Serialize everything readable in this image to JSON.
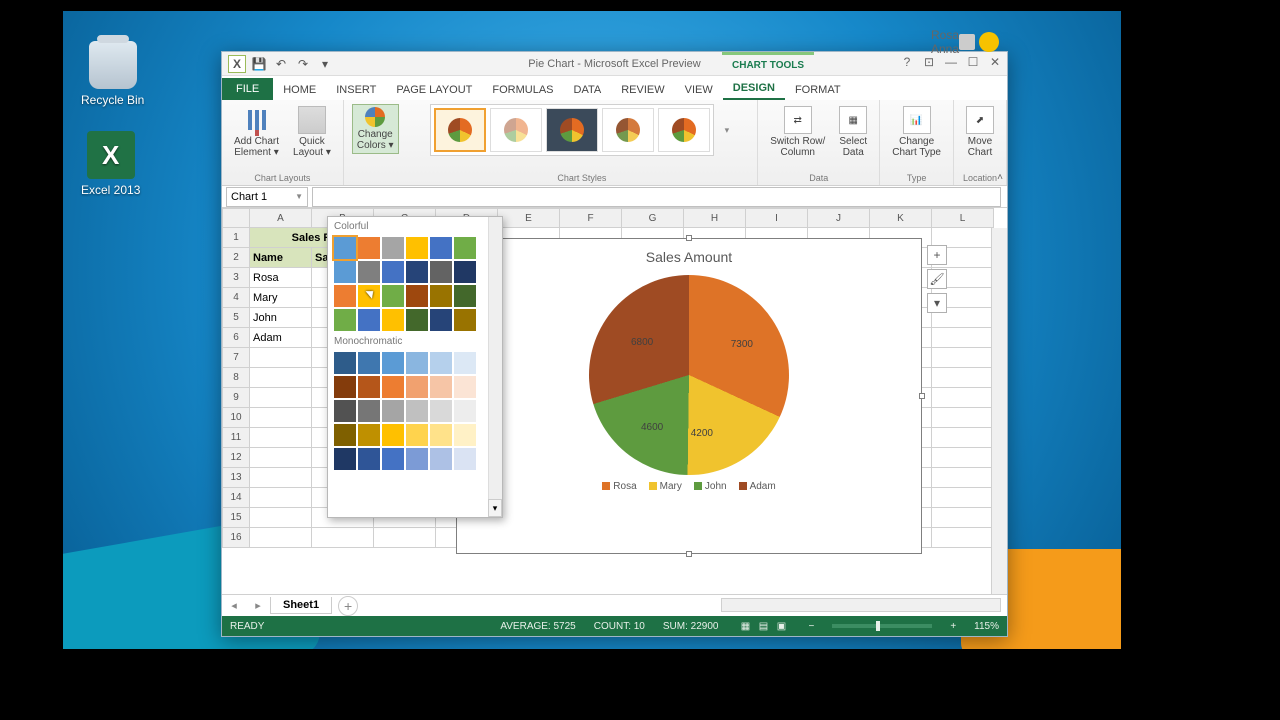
{
  "desktop": {
    "icons": [
      "Recycle Bin",
      "Excel 2013"
    ]
  },
  "window": {
    "title": "Pie Chart - Microsoft Excel Preview",
    "context_tab": "CHART TOOLS",
    "user": "Rosa Anna"
  },
  "ribbon": {
    "tabs": [
      "FILE",
      "HOME",
      "INSERT",
      "PAGE LAYOUT",
      "FORMULAS",
      "DATA",
      "REVIEW",
      "VIEW",
      "DESIGN",
      "FORMAT"
    ],
    "active": "DESIGN",
    "groups": {
      "layouts": "Chart Layouts",
      "styles": "Chart Styles",
      "data": "Data",
      "type": "Type",
      "location": "Location"
    },
    "buttons": {
      "add": "Add Chart\nElement ▾",
      "quick": "Quick\nLayout ▾",
      "colors": "Change\nColors ▾",
      "switch": "Switch Row/\nColumn",
      "select": "Select\nData",
      "ctype": "Change\nChart Type",
      "move": "Move\nChart"
    }
  },
  "popup": {
    "sec1": "Colorful",
    "sec2": "Monochromatic",
    "colorful": [
      [
        "#5b9bd5",
        "#ed7d31",
        "#a5a5a5",
        "#ffc000",
        "#4472c4",
        "#70ad47"
      ],
      [
        "#5b9bd5",
        "#7f7f7f",
        "#4472c4",
        "#264478",
        "#636363",
        "#203864"
      ],
      [
        "#ed7d31",
        "#ffc000",
        "#70ad47",
        "#9e480e",
        "#997300",
        "#43682b"
      ],
      [
        "#70ad47",
        "#4472c4",
        "#ffc000",
        "#43682b",
        "#264478",
        "#997300"
      ]
    ],
    "mono": [
      [
        "#2e5c8a",
        "#3f77af",
        "#5b9bd5",
        "#8ab6e0",
        "#b5d0ec",
        "#dce8f5"
      ],
      [
        "#843c0c",
        "#b5561a",
        "#ed7d31",
        "#f1a16f",
        "#f6c5a6",
        "#fbe4d5"
      ],
      [
        "#525252",
        "#767676",
        "#a5a5a5",
        "#c0c0c0",
        "#d9d9d9",
        "#ededed"
      ],
      [
        "#7f6000",
        "#bf9000",
        "#ffc000",
        "#ffd34d",
        "#ffe28a",
        "#fff1c6"
      ],
      [
        "#1f3864",
        "#2f5597",
        "#4472c4",
        "#7c9bd6",
        "#adc1e5",
        "#dae3f3"
      ]
    ]
  },
  "namebox": "Chart 1",
  "columns": [
    "A",
    "B",
    "C",
    "D",
    "E",
    "F",
    "G",
    "H",
    "I",
    "J",
    "K",
    "L"
  ],
  "sheet": {
    "title": "Sales R",
    "hdr_name": "Name",
    "hdr_amt": "Sal",
    "rows_data": [
      "Rosa",
      "Mary",
      "John",
      "Adam"
    ]
  },
  "chart_data": {
    "type": "pie",
    "title": "Sales Amount",
    "categories": [
      "Rosa",
      "Mary",
      "John",
      "Adam"
    ],
    "values": [
      7300,
      4200,
      4600,
      6800
    ],
    "colors": [
      "#de7327",
      "#f0c32e",
      "#5e9b3f",
      "#9f4b23"
    ]
  },
  "tabs": {
    "sheet": "Sheet1"
  },
  "status": {
    "ready": "READY",
    "avg": "AVERAGE: 5725",
    "count": "COUNT: 10",
    "sum": "SUM: 22900",
    "zoom": "115%"
  }
}
